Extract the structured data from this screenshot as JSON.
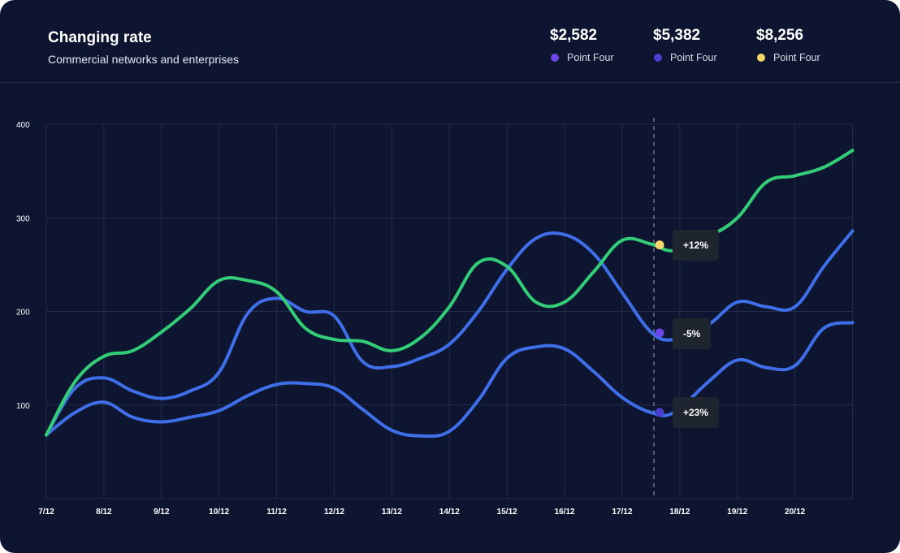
{
  "header": {
    "title": "Changing rate",
    "subtitle": "Commercial networks and enterprises"
  },
  "kpis": [
    {
      "value": "$2,582",
      "label": "Point Four",
      "color": "#6b46e6"
    },
    {
      "value": "$5,382",
      "label": "Point Four",
      "color": "#4a3fd0"
    },
    {
      "value": "$8,256",
      "label": "Point Four",
      "color": "#f4d66a"
    }
  ],
  "tooltips": [
    {
      "text": "+12%"
    },
    {
      "text": "-5%"
    },
    {
      "text": "+23%"
    }
  ],
  "chart_data": {
    "type": "line",
    "categories": [
      "7/12",
      "8/12",
      "9/12",
      "10/12",
      "11/12",
      "12/12",
      "13/12",
      "14/12",
      "15/12",
      "16/12",
      "17/12",
      "18/12",
      "19/12",
      "20/12",
      ""
    ],
    "ylim": [
      0,
      400
    ],
    "yticks": [
      100,
      200,
      300,
      400
    ],
    "grid": true,
    "marker_at": 10.55,
    "series": [
      {
        "color": "#33cc77",
        "x": [
          0,
          0.5,
          1,
          1.5,
          2,
          2.5,
          3,
          3.5,
          4,
          4.5,
          5,
          5.5,
          6,
          6.5,
          7,
          7.5,
          8,
          8.5,
          9,
          9.5,
          10,
          10.5,
          10.9,
          11.5,
          12,
          12.5,
          13,
          13.5,
          14
        ],
        "y": [
          68,
          125,
          152,
          158,
          178,
          203,
          233,
          233,
          221,
          182,
          170,
          168,
          158,
          172,
          205,
          252,
          248,
          210,
          210,
          242,
          276,
          272,
          265,
          280,
          300,
          338,
          345,
          354,
          372
        ]
      },
      {
        "color": "#3f6fe8",
        "x": [
          0,
          0.5,
          1,
          1.5,
          2,
          2.5,
          3,
          3.5,
          4,
          4.5,
          5,
          5.5,
          6,
          6.5,
          7,
          7.5,
          8,
          8.5,
          9,
          9.5,
          10,
          10.5,
          10.9,
          11.5,
          12,
          12.5,
          13,
          13.5,
          14
        ],
        "y": [
          68,
          118,
          129,
          115,
          107,
          115,
          135,
          198,
          214,
          200,
          195,
          146,
          141,
          150,
          165,
          200,
          245,
          278,
          282,
          262,
          220,
          178,
          170,
          186,
          210,
          205,
          205,
          248,
          286
        ]
      },
      {
        "color": "#3f6fe8",
        "x": [
          0,
          0.5,
          1,
          1.5,
          2,
          2.5,
          3,
          3.5,
          4,
          4.5,
          5,
          5.5,
          6,
          6.5,
          7,
          7.5,
          8,
          8.5,
          9,
          9.5,
          10,
          10.5,
          10.9,
          11.5,
          12,
          12.5,
          13,
          13.5,
          14
        ],
        "y": [
          68,
          92,
          103,
          87,
          82,
          87,
          94,
          110,
          122,
          123,
          118,
          95,
          73,
          67,
          72,
          105,
          150,
          162,
          160,
          136,
          108,
          92,
          92,
          125,
          148,
          140,
          142,
          182,
          188
        ]
      }
    ],
    "markers": [
      {
        "series": 0,
        "x": 10.65,
        "y": 271,
        "color": "#f4d66a"
      },
      {
        "series": 1,
        "x": 10.65,
        "y": 177,
        "color": "#6b46e6"
      },
      {
        "series": 2,
        "x": 10.65,
        "y": 92,
        "color": "#4a3fd0"
      }
    ]
  }
}
